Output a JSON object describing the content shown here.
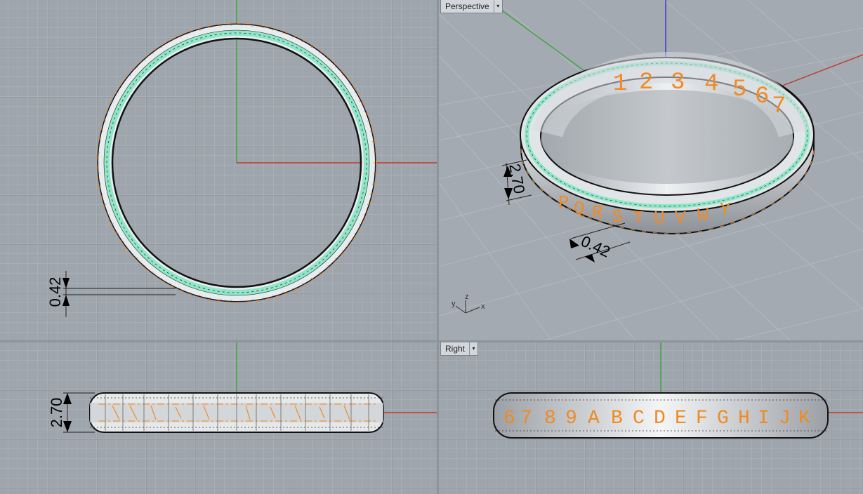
{
  "viewports": {
    "top": {
      "dimension": "0.42"
    },
    "perspective": {
      "label": "Perspective",
      "dropdown": "▾",
      "dims": [
        "2.70",
        "0.42"
      ],
      "axes": {
        "y": "y",
        "z": "z",
        "x": "x"
      },
      "engrave_numbers": [
        "1",
        "2",
        "3",
        "4",
        "5",
        "6",
        "7"
      ],
      "engrave_letters": [
        "P",
        "Q",
        "R",
        "S",
        "T",
        "U",
        "V",
        "W",
        "Y"
      ]
    },
    "front": {
      "dimension": "2.70"
    },
    "right": {
      "label": "Right",
      "dropdown": "▾",
      "engrave": [
        "6",
        "7",
        "8",
        "9",
        "A",
        "B",
        "C",
        "D",
        "E",
        "F",
        "G",
        "H",
        "I",
        "J",
        "K"
      ]
    }
  },
  "colors": {
    "grid_major": "#8f969e",
    "grid_minor": "#a7adb4",
    "axis_x": "#c03a2b",
    "axis_y": "#3aa33a",
    "axis_z": "#3535c8",
    "engrave": "#f08a24",
    "highlight": "#7fe8c0"
  }
}
